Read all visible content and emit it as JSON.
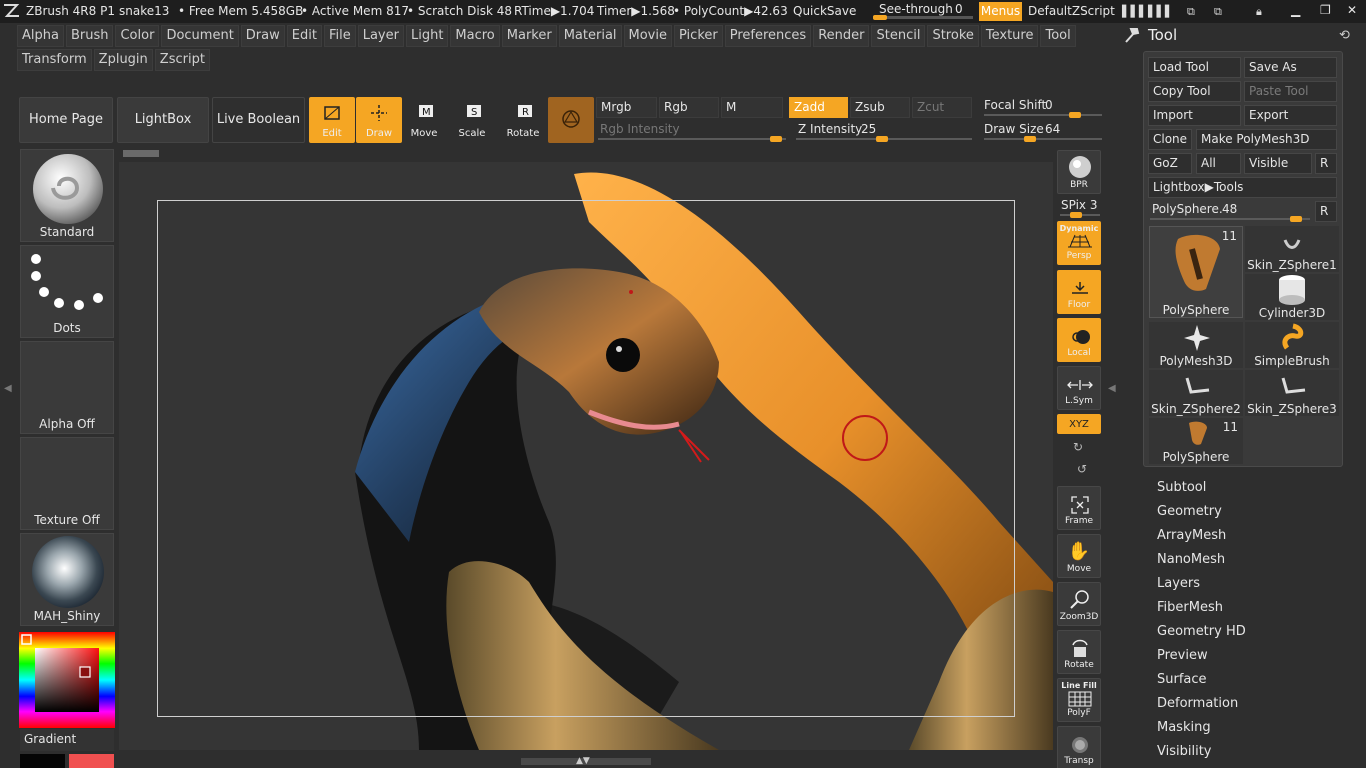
{
  "titlebar": {
    "app": "ZBrush 4R8 P1",
    "document": "snake13",
    "free_mem": "• Free Mem 5.458GB",
    "active_mem": "• Active Mem 817",
    "scratch_disk": "• Scratch Disk 48",
    "rtime": "RTime▶1.704",
    "timer": "Timer▶1.568",
    "polycount": "• PolyCount▶42.63",
    "quicksave": "QuickSave",
    "see_through_label": "See-through",
    "see_through_value": "0",
    "menus": "Menus",
    "zscript": "DefaultZScript"
  },
  "menus": {
    "row1": [
      "Alpha",
      "Brush",
      "Color",
      "Document",
      "Draw",
      "Edit",
      "File",
      "Layer",
      "Light",
      "Macro",
      "Marker",
      "Material",
      "Movie",
      "Picker",
      "Preferences",
      "Render",
      "Stencil",
      "Stroke",
      "Texture",
      "Tool"
    ],
    "row2": [
      "Transform",
      "Zplugin",
      "Zscript"
    ]
  },
  "toolbar": {
    "home_page": "Home Page",
    "lightbox": "LightBox",
    "live_boolean": "Live Boolean",
    "edit": "Edit",
    "draw": "Draw",
    "move": "Move",
    "scale": "Scale",
    "rotate": "Rotate",
    "mrgb": "Mrgb",
    "rgb": "Rgb",
    "m": "M",
    "zadd": "Zadd",
    "zsub": "Zsub",
    "zcut": "Zcut",
    "rgb_intensity": "Rgb Intensity",
    "z_intensity_label": "Z Intensity",
    "z_intensity_value": "25",
    "focal_shift_label": "Focal Shift",
    "focal_shift_value": "0",
    "draw_size_label": "Draw Size",
    "draw_size_value": "64"
  },
  "left_shelf": {
    "brush": "Standard",
    "stroke": "Dots",
    "alpha": "Alpha Off",
    "texture": "Texture Off",
    "material": "MAH_Shiny",
    "gradient": "Gradient"
  },
  "right_shelf": {
    "bpr": "BPR",
    "spix": "SPix 3",
    "dynamic": "Dynamic",
    "persp": "Persp",
    "floor": "Floor",
    "local": "Local",
    "lsym": "L.Sym",
    "xyz": "XYZ",
    "frame": "Frame",
    "move": "Move",
    "zoom3d": "Zoom3D",
    "rotate": "Rotate",
    "line_fill": "Line Fill",
    "polyf": "PolyF",
    "transp": "Transp"
  },
  "tool_palette": {
    "title": "Tool",
    "load_tool": "Load Tool",
    "save_as": "Save As",
    "copy_tool": "Copy Tool",
    "paste_tool": "Paste Tool",
    "import": "Import",
    "export": "Export",
    "clone": "Clone",
    "make_polymesh": "Make PolyMesh3D",
    "goz": "GoZ",
    "all": "All",
    "visible": "Visible",
    "r": "R",
    "lightbox_tools": "Lightbox▶Tools",
    "polysphere_label": "PolySphere.",
    "polysphere_value": "48",
    "thumbs": [
      {
        "name": "PolySphere",
        "count": "11"
      },
      {
        "name": "Skin_ZSphere1",
        "count": ""
      },
      {
        "name": "Cylinder3D",
        "count": ""
      },
      {
        "name": "PolyMesh3D",
        "count": ""
      },
      {
        "name": "SimpleBrush",
        "count": ""
      },
      {
        "name": "Skin_ZSphere2",
        "count": ""
      },
      {
        "name": "Skin_ZSphere3",
        "count": ""
      },
      {
        "name": "PolySphere",
        "count": "11"
      }
    ],
    "subpalettes": [
      "Subtool",
      "Geometry",
      "ArrayMesh",
      "NanoMesh",
      "Layers",
      "FiberMesh",
      "Geometry HD",
      "Preview",
      "Surface",
      "Deformation",
      "Masking",
      "Visibility"
    ]
  },
  "colors": {
    "accent": "#f5a623",
    "main_color": "#c01818",
    "secondary_color": "#f05050"
  }
}
